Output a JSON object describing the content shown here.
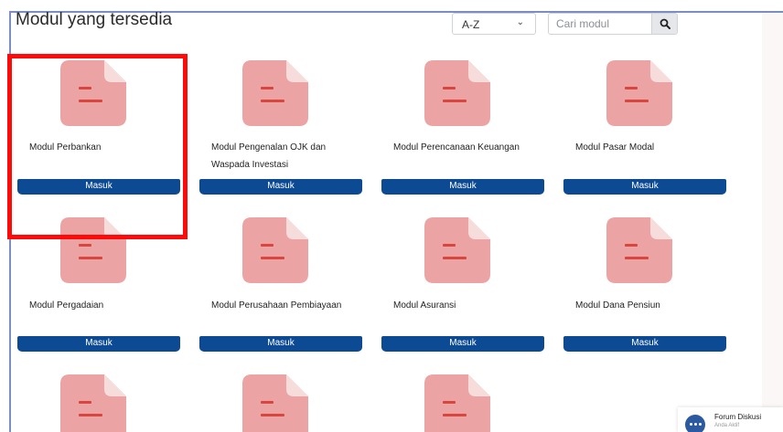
{
  "header": {
    "title": "Modul yang tersedia",
    "sort": {
      "selected": "A-Z"
    },
    "search": {
      "placeholder": "Cari modul"
    }
  },
  "modules": [
    {
      "label": "Modul Perbankan",
      "button": "Masuk"
    },
    {
      "label": "Modul Pengenalan OJK dan Waspada Investasi",
      "button": "Masuk"
    },
    {
      "label": "Modul Perencanaan Keuangan",
      "button": "Masuk"
    },
    {
      "label": "Modul Pasar Modal",
      "button": "Masuk"
    },
    {
      "label": "Modul Pergadaian",
      "button": "Masuk"
    },
    {
      "label": "Modul Perusahaan Pembiayaan",
      "button": "Masuk"
    },
    {
      "label": "Modul Asuransi",
      "button": "Masuk"
    },
    {
      "label": "Modul Dana Pensiun",
      "button": "Masuk"
    }
  ],
  "forum": {
    "title": "Forum Diskusi",
    "status": "Anda Aktif"
  },
  "colors": {
    "accent": "#0d4a94",
    "file_icon": "#eba3a3",
    "file_lines": "#d9463f",
    "highlight": "#ff0a0a"
  }
}
